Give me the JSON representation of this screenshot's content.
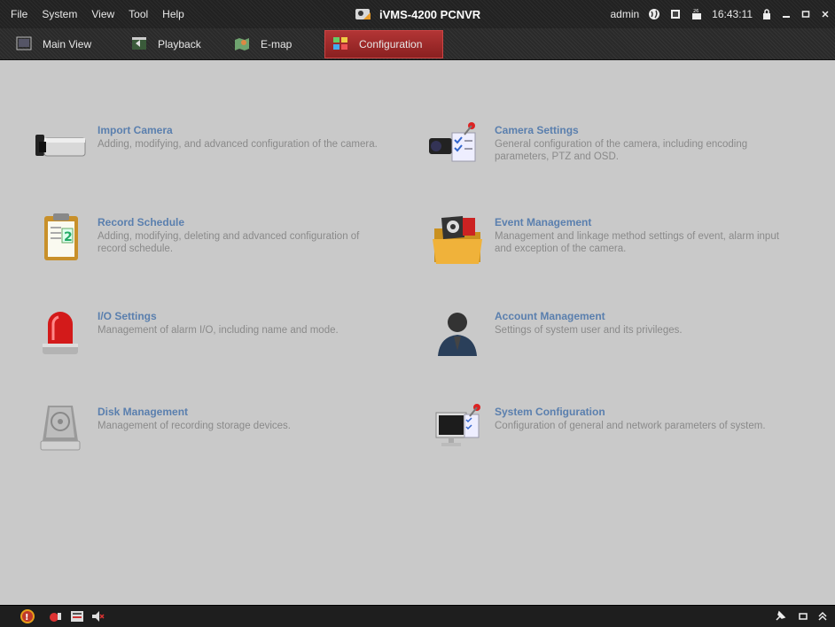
{
  "menu": {
    "items": [
      "File",
      "System",
      "View",
      "Tool",
      "Help"
    ]
  },
  "app_title": "iVMS-4200 PCNVR",
  "status": {
    "user": "admin",
    "time": "16:43:11"
  },
  "tabs": [
    {
      "label": "Main View",
      "icon": "monitor-icon"
    },
    {
      "label": "Playback",
      "icon": "playback-icon"
    },
    {
      "label": "E-map",
      "icon": "map-icon"
    },
    {
      "label": "Configuration",
      "icon": "grid-icon",
      "active": true
    }
  ],
  "cards": [
    {
      "title": "Import Camera",
      "desc": "Adding, modifying, and advanced configuration of the camera.",
      "icon": "camera-icon"
    },
    {
      "title": "Camera Settings",
      "desc": "General configuration of the camera, including encoding parameters, PTZ and OSD.",
      "icon": "camera-settings-icon"
    },
    {
      "title": "Record Schedule",
      "desc": "Adding, modifying, deleting and advanced configuration of record schedule.",
      "icon": "clipboard-icon"
    },
    {
      "title": "Event Management",
      "desc": "Management and linkage method settings of event, alarm input and exception of the camera.",
      "icon": "folder-icon"
    },
    {
      "title": "I/O Settings",
      "desc": "Management of alarm I/O, including name and mode.",
      "icon": "alarm-light-icon"
    },
    {
      "title": "Account Management",
      "desc": "Settings of system user and its privileges.",
      "icon": "user-icon"
    },
    {
      "title": "Disk Management",
      "desc": "Management of recording storage devices.",
      "icon": "disk-icon"
    },
    {
      "title": "System Configuration",
      "desc": "Configuration of general and network parameters of system.",
      "icon": "computer-icon"
    }
  ],
  "colors": {
    "accent_tab": "#a52a2a",
    "link_title": "#5a7fae",
    "desc_text": "#8a8a8a",
    "background": "#c9c9c9"
  }
}
